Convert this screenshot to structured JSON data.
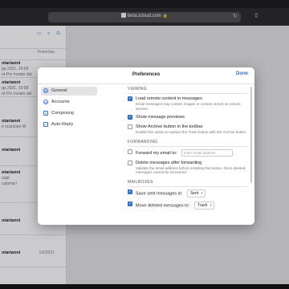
{
  "browser": {
    "url": "beta.icloud.com"
  },
  "mail_list": {
    "items": [
      {
        "sender": "",
        "date": "",
        "line1": "",
        "line2": ""
      },
      {
        "sender": "",
        "date": "Yesterday",
        "line1": "",
        "line2": ""
      },
      {
        "sender": "otarianni",
        "date": "",
        "line1": "gu 2021, 10:09",
        "line2": "nt Pro Inviato dal"
      },
      {
        "sender": "otarianni",
        "date": "",
        "line1": "gu 2021, 10:08",
        "line2": "nt Pro Inviato dal"
      },
      {
        "sender": "otarianni",
        "date": "",
        "line1": "",
        "line2": "e scaricare M"
      },
      {
        "sender": "otarianni",
        "date": "",
        "line1": "",
        "line2": ""
      },
      {
        "sender": "otarianni",
        "date": "",
        "line1": "oopt",
        "line2": "cuperaci"
      },
      {
        "sender": "otarianni",
        "date": "",
        "line1": "",
        "line2": ""
      },
      {
        "sender": "otarianni",
        "date": "1/6/2021",
        "line1": "",
        "line2": ""
      }
    ]
  },
  "preferences": {
    "title": "Preferences",
    "done_label": "Done",
    "nav": [
      {
        "label": "General",
        "icon": "gear-icon"
      },
      {
        "label": "Accounts",
        "icon": "at-icon"
      },
      {
        "label": "Composing",
        "icon": "pencil-icon"
      },
      {
        "label": "Auto-Reply",
        "icon": "reply-icon"
      }
    ],
    "viewing": {
      "heading": "VIEWING",
      "load_remote": {
        "label": "Load remote content in messages",
        "desc": "Email messages may contain images or content stored on remote servers.",
        "checked": true
      },
      "previews": {
        "label": "Show message previews",
        "checked": true
      },
      "archive": {
        "label": "Show Archive button in the toolbar",
        "desc": "Enable this option to replace the Trash button with the Archive button.",
        "checked": false
      }
    },
    "forwarding": {
      "heading": "FORWARDING",
      "forward": {
        "label": "Forward my email to:",
        "placeholder": "enter email address",
        "checked": false
      },
      "delete": {
        "label": "Delete messages after forwarding",
        "desc": "Validate the email address before enabling this button. Once deleted, messages cannot be recovered.",
        "checked": false
      }
    },
    "mailboxes": {
      "heading": "MAILBOXES",
      "save_sent": {
        "label": "Save sent messages in:",
        "value": "Sent",
        "checked": true
      },
      "move_deleted": {
        "label": "Move deleted messages to:",
        "value": "Trash",
        "checked": true
      }
    }
  }
}
